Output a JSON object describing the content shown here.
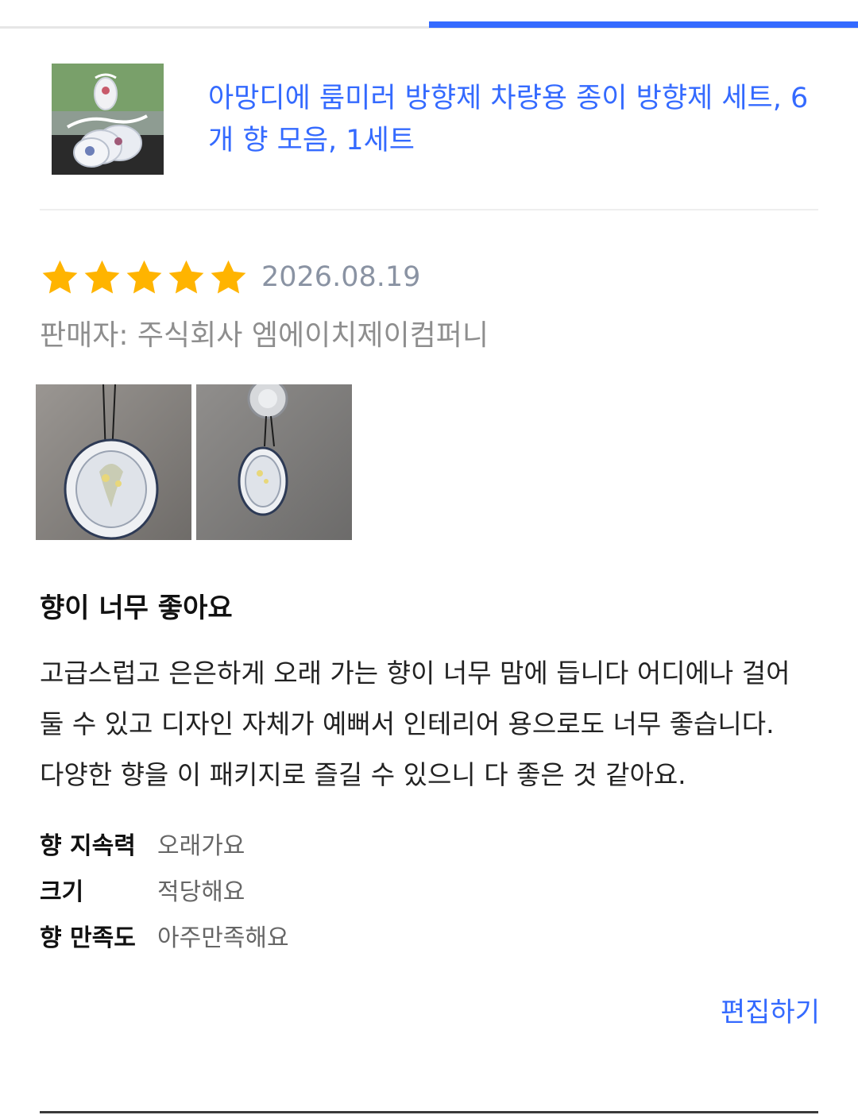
{
  "tab_bar": {
    "active_tab_index": 1,
    "tab_count": 2,
    "active_color": "#346aff"
  },
  "product": {
    "thumbnail_icon": "product-thumbnail",
    "title": "아망디에 룸미러 방향제 차량용 종이 방향제 세트, 6개 향 모음, 1세트",
    "title_color": "#346aff"
  },
  "review": {
    "rating": 5,
    "rating_max": 5,
    "star_color": "#ffb400",
    "date": "2026.08.19",
    "seller": "판매자: 주식회사 엠에이치제이컴퍼니",
    "photos": [
      {
        "icon": "review-photo-1"
      },
      {
        "icon": "review-photo-2"
      }
    ],
    "headline": "향이 너무 좋아요",
    "content": "고급스럽고 은은하게 오래 가는 향이 너무 맘에 듭니다 어디에나 걸어\n둘 수 있고 디자인 자체가 예뻐서 인테리어 용으로도 너무 좋습니다.\n다양한 향을 이 패키지로 즐길 수 있으니 다 좋은 것 같아요.",
    "survey": [
      {
        "question": "향 지속력",
        "answer": "오래가요"
      },
      {
        "question": "크기",
        "answer": "적당해요"
      },
      {
        "question": "향 만족도",
        "answer": "아주만족해요"
      }
    ],
    "edit_label": "편집하기"
  }
}
